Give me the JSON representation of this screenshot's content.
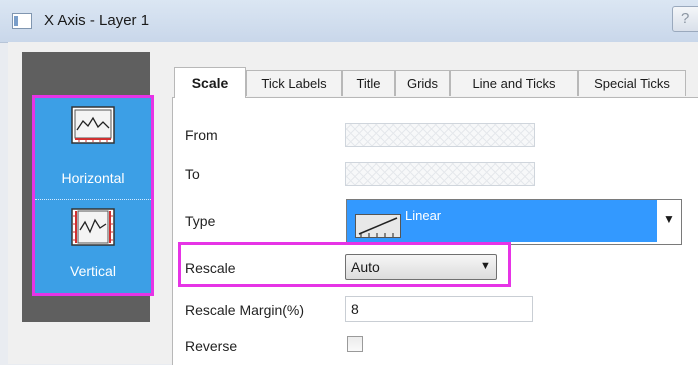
{
  "window": {
    "title": "X Axis - Layer 1",
    "help_label": "?"
  },
  "axis_list": {
    "items": [
      {
        "label": "Horizontal",
        "icon": "horizontal-axis-icon"
      },
      {
        "label": "Vertical",
        "icon": "vertical-axis-icon"
      }
    ],
    "selected_color": "#3c9fe6",
    "highlight_color": "#e634e6"
  },
  "tabs": [
    "Scale",
    "Tick Labels",
    "Title",
    "Grids",
    "Line and Ticks",
    "Special Ticks"
  ],
  "active_tab": "Scale",
  "scale": {
    "from": {
      "label": "From",
      "value": ""
    },
    "to": {
      "label": "To",
      "value": ""
    },
    "type": {
      "label": "Type",
      "value": "Linear"
    },
    "rescale": {
      "label": "Rescale",
      "value": "Auto"
    },
    "rescale_margin": {
      "label": "Rescale Margin(%)",
      "value": "8"
    },
    "reverse": {
      "label": "Reverse",
      "checked": false
    }
  }
}
